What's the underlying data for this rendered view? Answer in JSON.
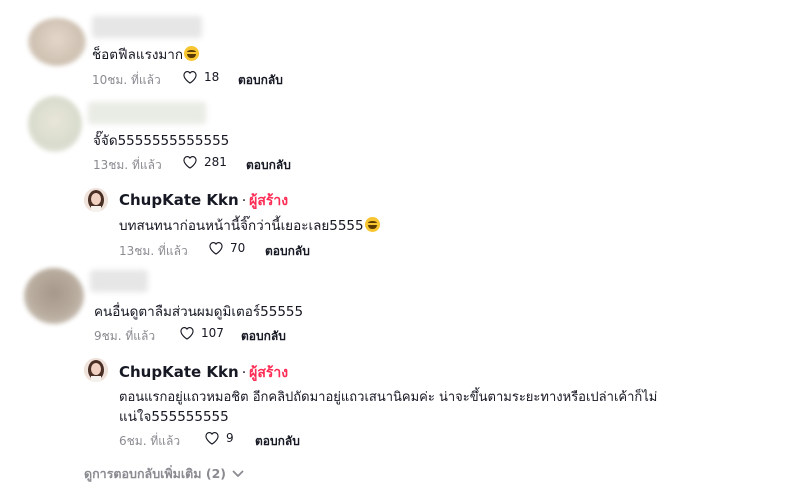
{
  "comments": [
    {
      "text": "ช็อตฟีลแรงมาก",
      "time": "10ชม. ที่แล้ว",
      "likes": "18",
      "reply": "ตอบกลับ"
    },
    {
      "text": "จั๊จัด5555555555555",
      "time": "13ชม. ที่แล้ว",
      "likes": "281",
      "reply": "ตอบกลับ"
    },
    {
      "text": "คนอื่นดูตาลืมส่วนผมดูมิเตอร์55555",
      "time": "9ชม. ที่แล้ว",
      "likes": "107",
      "reply": "ตอบกลับ"
    }
  ],
  "replies": [
    {
      "username": "ChupKate Kkn",
      "dot": "·",
      "badge": "ผู้สร้าง",
      "text": "บทสนทนาก่อนหน้านี้จิ๊กว่านี้เยอะเลย5555",
      "time": "13ชม. ที่แล้ว",
      "likes": "70",
      "reply": "ตอบกลับ"
    },
    {
      "username": "ChupKate Kkn",
      "dot": "·",
      "badge": "ผู้สร้าง",
      "text_line1": "ตอนแรกอยู่แถวหมอชิต อีกคลิปถัดมาอยู่แถวเสนานิคมค่ะ น่าจะขึ้นตามระยะทางหรือเปล่าเค้าก็ไม่",
      "text_line2": "แน่ใจ555555555",
      "time": "6ชม. ที่แล้ว",
      "likes": "9",
      "reply": "ตอบกลับ"
    }
  ],
  "more_replies": "ดูการตอบกลับเพิ่มเติม (2)",
  "colors": {
    "creator": "#fe2c55",
    "meta": "#8a8b91",
    "text": "#161823"
  }
}
